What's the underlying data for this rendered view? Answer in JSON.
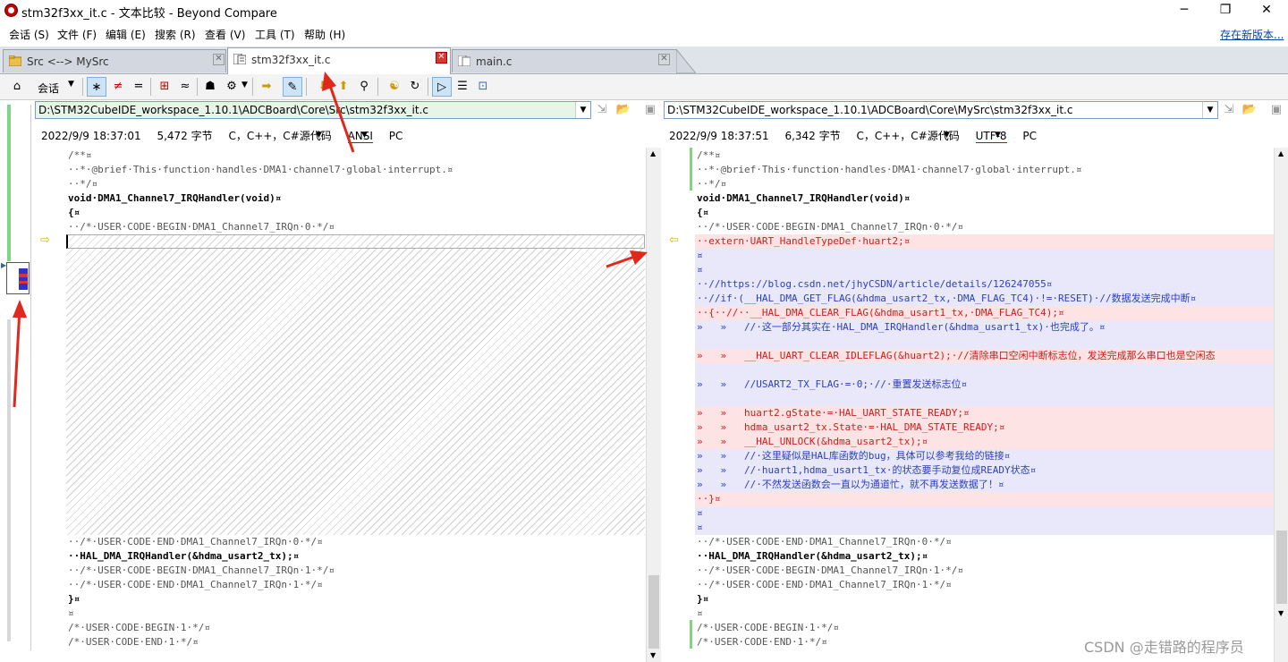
{
  "window": {
    "title": "stm32f3xx_it.c - 文本比较 - Beyond Compare",
    "minimize": "─",
    "maximize": "❐",
    "close": "✕"
  },
  "menu": {
    "items": [
      "会话 (S)",
      "文件 (F)",
      "编辑 (E)",
      "搜索 (R)",
      "查看 (V)",
      "工具 (T)",
      "帮助 (H)"
    ],
    "new_version": "存在新版本..."
  },
  "tabs": [
    {
      "label": "Src <--> MySrc",
      "icon": "folder-compare-icon",
      "active": false
    },
    {
      "label": "stm32f3xx_it.c",
      "icon": "text-compare-icon",
      "active": true
    },
    {
      "label": "main.c",
      "icon": "text-compare-icon",
      "active": false
    }
  ],
  "toolbar": {
    "session_label": "会话",
    "buttons": [
      "home-icon",
      "all-diffs-icon",
      "diffs-icon",
      "same-icon",
      "context-icon",
      "minor-icon",
      "rules-icon",
      "format-icon",
      "next-section-icon",
      "edit-icon",
      "prev-diff-icon",
      "next-diff-icon",
      "find-icon",
      "swap-icon",
      "refresh-icon",
      "view-icon",
      "list-icon",
      "sync-icon"
    ]
  },
  "left": {
    "path": "D:\\STM32CubeIDE_workspace_1.10.1\\ADCBoard\\Core\\Src\\stm32f3xx_it.c",
    "date": "2022/9/9 18:37:01",
    "size": "5,472 字节",
    "format": "C，C++，C#源代码",
    "encoding": "ANSI",
    "lineend": "PC"
  },
  "right": {
    "path": "D:\\STM32CubeIDE_workspace_1.10.1\\ADCBoard\\Core\\MySrc\\stm32f3xx_it.c",
    "date": "2022/9/9 18:37:51",
    "size": "6,342 字节",
    "format": "C，C++，C#源代码",
    "encoding": "UTF-8",
    "lineend": "PC"
  },
  "left_lines": [
    {
      "t": "/**¤",
      "s": "same"
    },
    {
      "t": "··*·@brief·This·function·handles·DMA1·channel7·global·interrupt.¤",
      "s": "same"
    },
    {
      "t": "··*/¤",
      "s": "same"
    },
    {
      "t": "void·DMA1_Channel7_IRQHandler(void)¤",
      "s": "bold"
    },
    {
      "t": "{¤",
      "s": "bold"
    },
    {
      "t": "··/*·USER·CODE·BEGIN·DMA1_Channel7_IRQn·0·*/¤",
      "s": "same"
    },
    {
      "t": "",
      "s": "cursor"
    },
    {
      "t": "",
      "s": "hatch"
    },
    {
      "t": "··/*·USER·CODE·END·DMA1_Channel7_IRQn·0·*/¤",
      "s": "same"
    },
    {
      "t": "··HAL_DMA_IRQHandler(&hdma_usart2_tx);¤",
      "s": "bold"
    },
    {
      "t": "··/*·USER·CODE·BEGIN·DMA1_Channel7_IRQn·1·*/¤",
      "s": "same"
    },
    {
      "t": "··/*·USER·CODE·END·DMA1_Channel7_IRQn·1·*/¤",
      "s": "same"
    },
    {
      "t": "}¤",
      "s": "bold"
    },
    {
      "t": "¤",
      "s": "same"
    },
    {
      "t": "/*·USER·CODE·BEGIN·1·*/¤",
      "s": "same"
    },
    {
      "t": "/*·USER·CODE·END·1·*/¤",
      "s": "same"
    }
  ],
  "right_lines": [
    {
      "t": "/**¤",
      "s": "same"
    },
    {
      "t": "··*·@brief·This·function·handles·DMA1·channel7·global·interrupt.¤",
      "s": "same"
    },
    {
      "t": "··*/¤",
      "s": "same"
    },
    {
      "t": "void·DMA1_Channel7_IRQHandler(void)¤",
      "s": "bold"
    },
    {
      "t": "{¤",
      "s": "bold"
    },
    {
      "t": "··/*·USER·CODE·BEGIN·DMA1_Channel7_IRQn·0·*/¤",
      "s": "same"
    },
    {
      "t": "··extern·UART_HandleTypeDef·huart2;¤",
      "s": "red"
    },
    {
      "t": "¤",
      "s": "blue"
    },
    {
      "t": "¤",
      "s": "blue"
    },
    {
      "t": "··//https://blog.csdn.net/jhyCSDN/article/details/126247055¤",
      "s": "blue"
    },
    {
      "t": "··//if·(__HAL_DMA_GET_FLAG(&hdma_usart2_tx,·DMA_FLAG_TC4)·!=·RESET)·//数据发送完成中断¤",
      "s": "blue"
    },
    {
      "t": "··{··//··__HAL_DMA_CLEAR_FLAG(&hdma_usart1_tx,·DMA_FLAG_TC4);¤",
      "s": "red"
    },
    {
      "t": "»   »   //·这一部分其实在·HAL_DMA_IRQHandler(&hdma_usart1_tx)·也完成了。¤",
      "s": "blue"
    },
    {
      "t": "",
      "s": "blue"
    },
    {
      "t": "»   »   __HAL_UART_CLEAR_IDLEFLAG(&huart2);·//清除串口空闲中断标志位，发送完成那么串口也是空闲态",
      "s": "red"
    },
    {
      "t": "",
      "s": "blue"
    },
    {
      "t": "»   »   //USART2_TX_FLAG·=·0;·//·重置发送标志位¤",
      "s": "blue"
    },
    {
      "t": "",
      "s": "blue"
    },
    {
      "t": "»   »   huart2.gState·=·HAL_UART_STATE_READY;¤",
      "s": "red"
    },
    {
      "t": "»   »   hdma_usart2_tx.State·=·HAL_DMA_STATE_READY;¤",
      "s": "red"
    },
    {
      "t": "»   »   __HAL_UNLOCK(&hdma_usart2_tx);¤",
      "s": "red"
    },
    {
      "t": "»   »   //·这里疑似是HAL库函数的bug，具体可以参考我给的链接¤",
      "s": "blue"
    },
    {
      "t": "»   »   //·huart1,hdma_usart1_tx·的状态要手动复位成READY状态¤",
      "s": "blue"
    },
    {
      "t": "»   »   //·不然发送函数会一直以为通道忙，就不再发送数据了！¤",
      "s": "blue"
    },
    {
      "t": "··}¤",
      "s": "red"
    },
    {
      "t": "¤",
      "s": "blue"
    },
    {
      "t": "¤",
      "s": "blue"
    },
    {
      "t": "··/*·USER·CODE·END·DMA1_Channel7_IRQn·0·*/¤",
      "s": "same"
    },
    {
      "t": "··HAL_DMA_IRQHandler(&hdma_usart2_tx);¤",
      "s": "bold"
    },
    {
      "t": "··/*·USER·CODE·BEGIN·DMA1_Channel7_IRQn·1·*/¤",
      "s": "same"
    },
    {
      "t": "··/*·USER·CODE·END·DMA1_Channel7_IRQn·1·*/¤",
      "s": "same"
    },
    {
      "t": "}¤",
      "s": "bold"
    },
    {
      "t": "¤",
      "s": "same"
    },
    {
      "t": "/*·USER·CODE·BEGIN·1·*/¤",
      "s": "same"
    },
    {
      "t": "/*·USER·CODE·END·1·*/¤",
      "s": "same"
    }
  ],
  "watermark": "CSDN @走错路的程序员",
  "colors": {
    "diff_red": "#fde3e3",
    "diff_blue": "#e8e8fa",
    "annotation": "#e0281c"
  }
}
